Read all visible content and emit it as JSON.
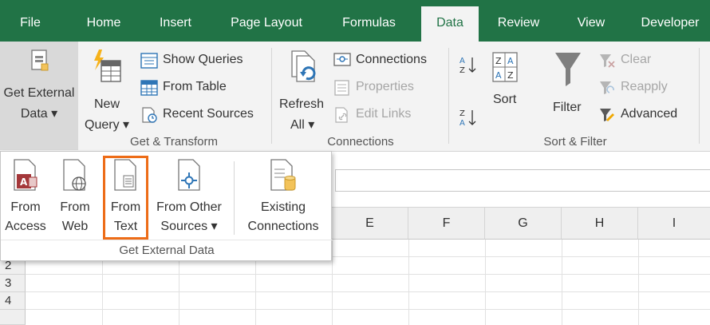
{
  "tabs": [
    "File",
    "Home",
    "Insert",
    "Page Layout",
    "Formulas",
    "Data",
    "Review",
    "View",
    "Developer"
  ],
  "active_tab": "Data",
  "ribbon": {
    "get_external_data": {
      "line1": "Get External",
      "line2": "Data ▾"
    },
    "new_query": {
      "line1": "New",
      "line2": "Query ▾"
    },
    "show_queries": "Show Queries",
    "from_table": "From Table",
    "recent_sources": "Recent Sources",
    "get_transform_label": "Get & Transform",
    "refresh_all": {
      "line1": "Refresh",
      "line2": "All ▾"
    },
    "connections": "Connections",
    "properties": "Properties",
    "edit_links": "Edit Links",
    "connections_label": "Connections",
    "sort": "Sort",
    "filter": "Filter",
    "clear": "Clear",
    "reapply": "Reapply",
    "advanced": "Advanced",
    "sort_filter_label": "Sort & Filter"
  },
  "dropdown": {
    "from_access": {
      "line1": "From",
      "line2": "Access"
    },
    "from_web": {
      "line1": "From",
      "line2": "Web"
    },
    "from_text": {
      "line1": "From",
      "line2": "Text"
    },
    "from_other": {
      "line1": "From Other",
      "line2": "Sources ▾"
    },
    "existing": {
      "line1": "Existing",
      "line2": "Connections"
    },
    "group_label": "Get External Data"
  },
  "sheet": {
    "columns": [
      "E",
      "F",
      "G",
      "H",
      "I"
    ],
    "rows": [
      "2",
      "3",
      "4"
    ]
  },
  "colors": {
    "excel_green": "#217346",
    "highlight": "#ed6c17"
  }
}
